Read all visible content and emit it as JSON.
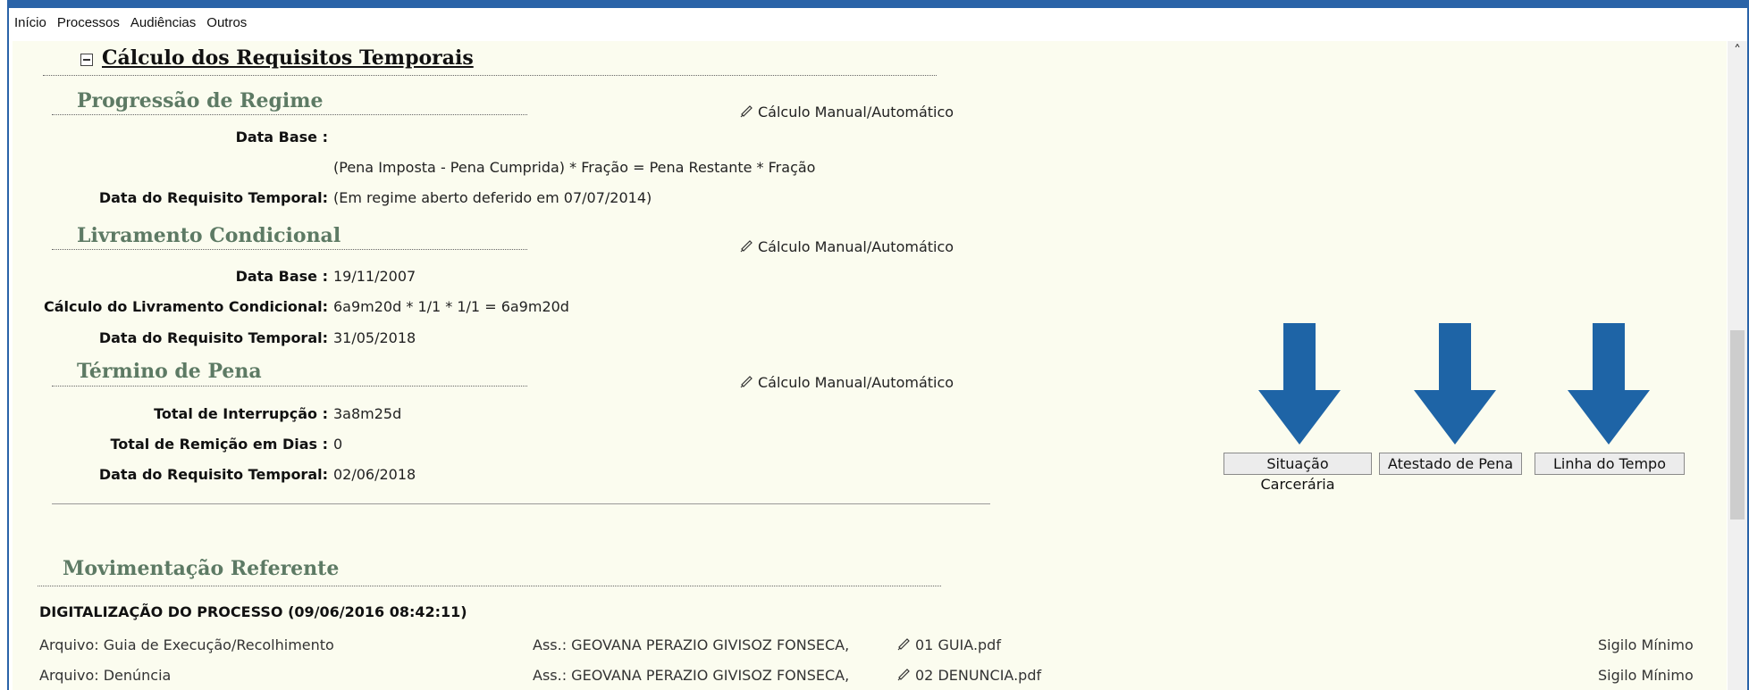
{
  "menu": [
    "Início",
    "Processos",
    "Audiências",
    "Outros"
  ],
  "main_title": "Cálculo dos Requisitos Temporais",
  "manual_link": "Cálculo Manual/Automático",
  "progressao": {
    "title": "Progressão de Regime",
    "data_base_label": "Data Base :",
    "data_base_value": "",
    "formula": "(Pena Imposta - Pena Cumprida) * Fração = Pena Restante * Fração",
    "requisito_label": "Data do Requisito Temporal:",
    "requisito_value": "(Em regime aberto deferido em 07/07/2014)"
  },
  "livramento": {
    "title": "Livramento Condicional",
    "data_base_label": "Data Base :",
    "data_base_value": "19/11/2007",
    "calculo_label": "Cálculo do Livramento Condicional:",
    "calculo_value": "6a9m20d * 1/1 * 1/1 = 6a9m20d",
    "requisito_label": "Data do Requisito Temporal:",
    "requisito_value": "31/05/2018"
  },
  "termino": {
    "title": "Término de Pena",
    "interrupcao_label": "Total de Interrupção :",
    "interrupcao_value": "3a8m25d",
    "remicao_label": "Total de Remição em Dias :",
    "remicao_value": "0",
    "requisito_label": "Data do Requisito Temporal:",
    "requisito_value": "02/06/2018"
  },
  "buttons": {
    "situacao": "Situação Carcerária",
    "atestado": "Atestado de Pena",
    "linha": "Linha do Tempo"
  },
  "colors": {
    "arrow": "#1e64a6",
    "section_title": "#5d7a64",
    "frame": "#2a63a8"
  },
  "movimentacao": {
    "title": "Movimentação Referente",
    "event": "DIGITALIZAÇÃO DO PROCESSO (09/06/2016 08:42:11)",
    "rows": [
      {
        "arquivo": "Arquivo: Guia de Execução/Recolhimento",
        "ass": "Ass.: GEOVANA PERAZIO GIVISOZ FONSECA,",
        "file": "01 GUIA.pdf",
        "sigilo": "Sigilo Mínimo"
      },
      {
        "arquivo": "Arquivo: Denúncia",
        "ass": "Ass.: GEOVANA PERAZIO GIVISOZ FONSECA,",
        "file": "02 DENUNCIA.pdf",
        "sigilo": "Sigilo Mínimo"
      }
    ]
  }
}
